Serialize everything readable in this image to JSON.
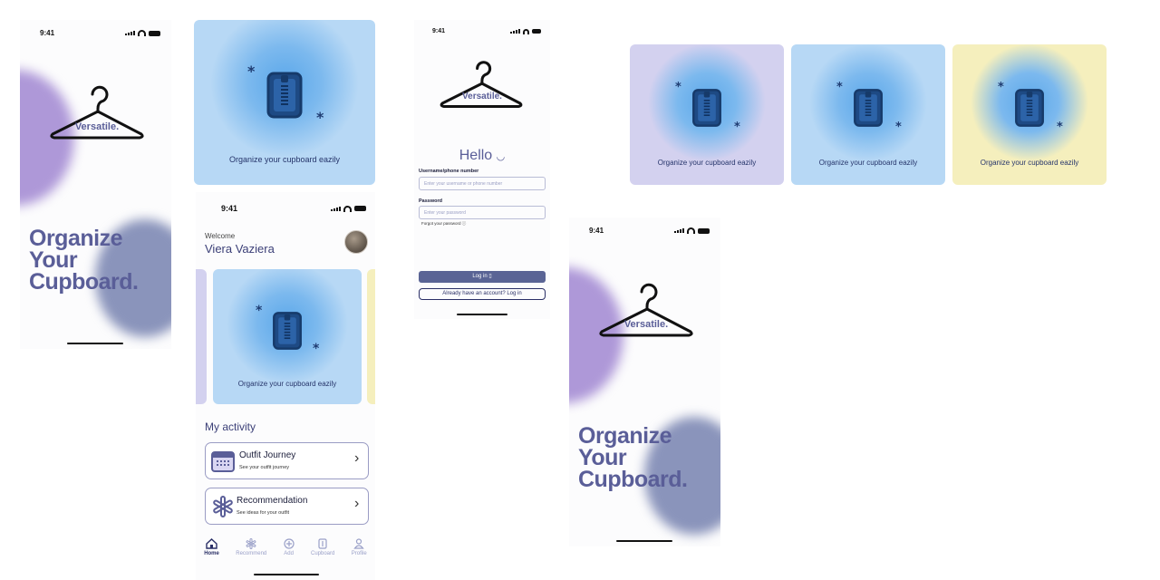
{
  "colors": {
    "brand_purple": "#5a5e98",
    "lavender_card": "#d3d1ef",
    "blue_card": "#b7d8f5",
    "yellow_card": "#f5efbd",
    "primary_button": "#5a6495"
  },
  "status": {
    "time": "9:41"
  },
  "brand": {
    "logo_text": "Versatile."
  },
  "splash": {
    "tagline_line1": "Organize",
    "tagline_line2": "Your",
    "tagline_line3": "Cupboard."
  },
  "promo": {
    "caption": "Organize your cupboard eazily",
    "icon": "clipboard-zipper-icon"
  },
  "home": {
    "welcome": "Welcome",
    "user_name": "Viera Vaziera",
    "section_title": "My activity",
    "activities": [
      {
        "title": "Outfit Journey",
        "subtitle": "See your outfit journey",
        "icon": "calendar-icon"
      },
      {
        "title": "Recommendation",
        "subtitle": "See ideas for your outfit",
        "icon": "sparkle-icon"
      }
    ],
    "tabs": [
      {
        "label": "Home",
        "icon": "home-icon",
        "active": true
      },
      {
        "label": "Recommend",
        "icon": "sparkle-icon",
        "active": false
      },
      {
        "label": "Add",
        "icon": "plus-circle-icon",
        "active": false
      },
      {
        "label": "Cupboard",
        "icon": "cupboard-icon",
        "active": false
      },
      {
        "label": "Profile",
        "icon": "user-icon",
        "active": false
      }
    ]
  },
  "login": {
    "greeting": "Hello",
    "username_label": "Username/phone number",
    "username_placeholder": "Enter your username or phone number",
    "password_label": "Password",
    "password_placeholder": "Enter your password",
    "forgot": "Forgot your password",
    "login_button": "Log in",
    "account_button": "Already have an account? Log in"
  }
}
